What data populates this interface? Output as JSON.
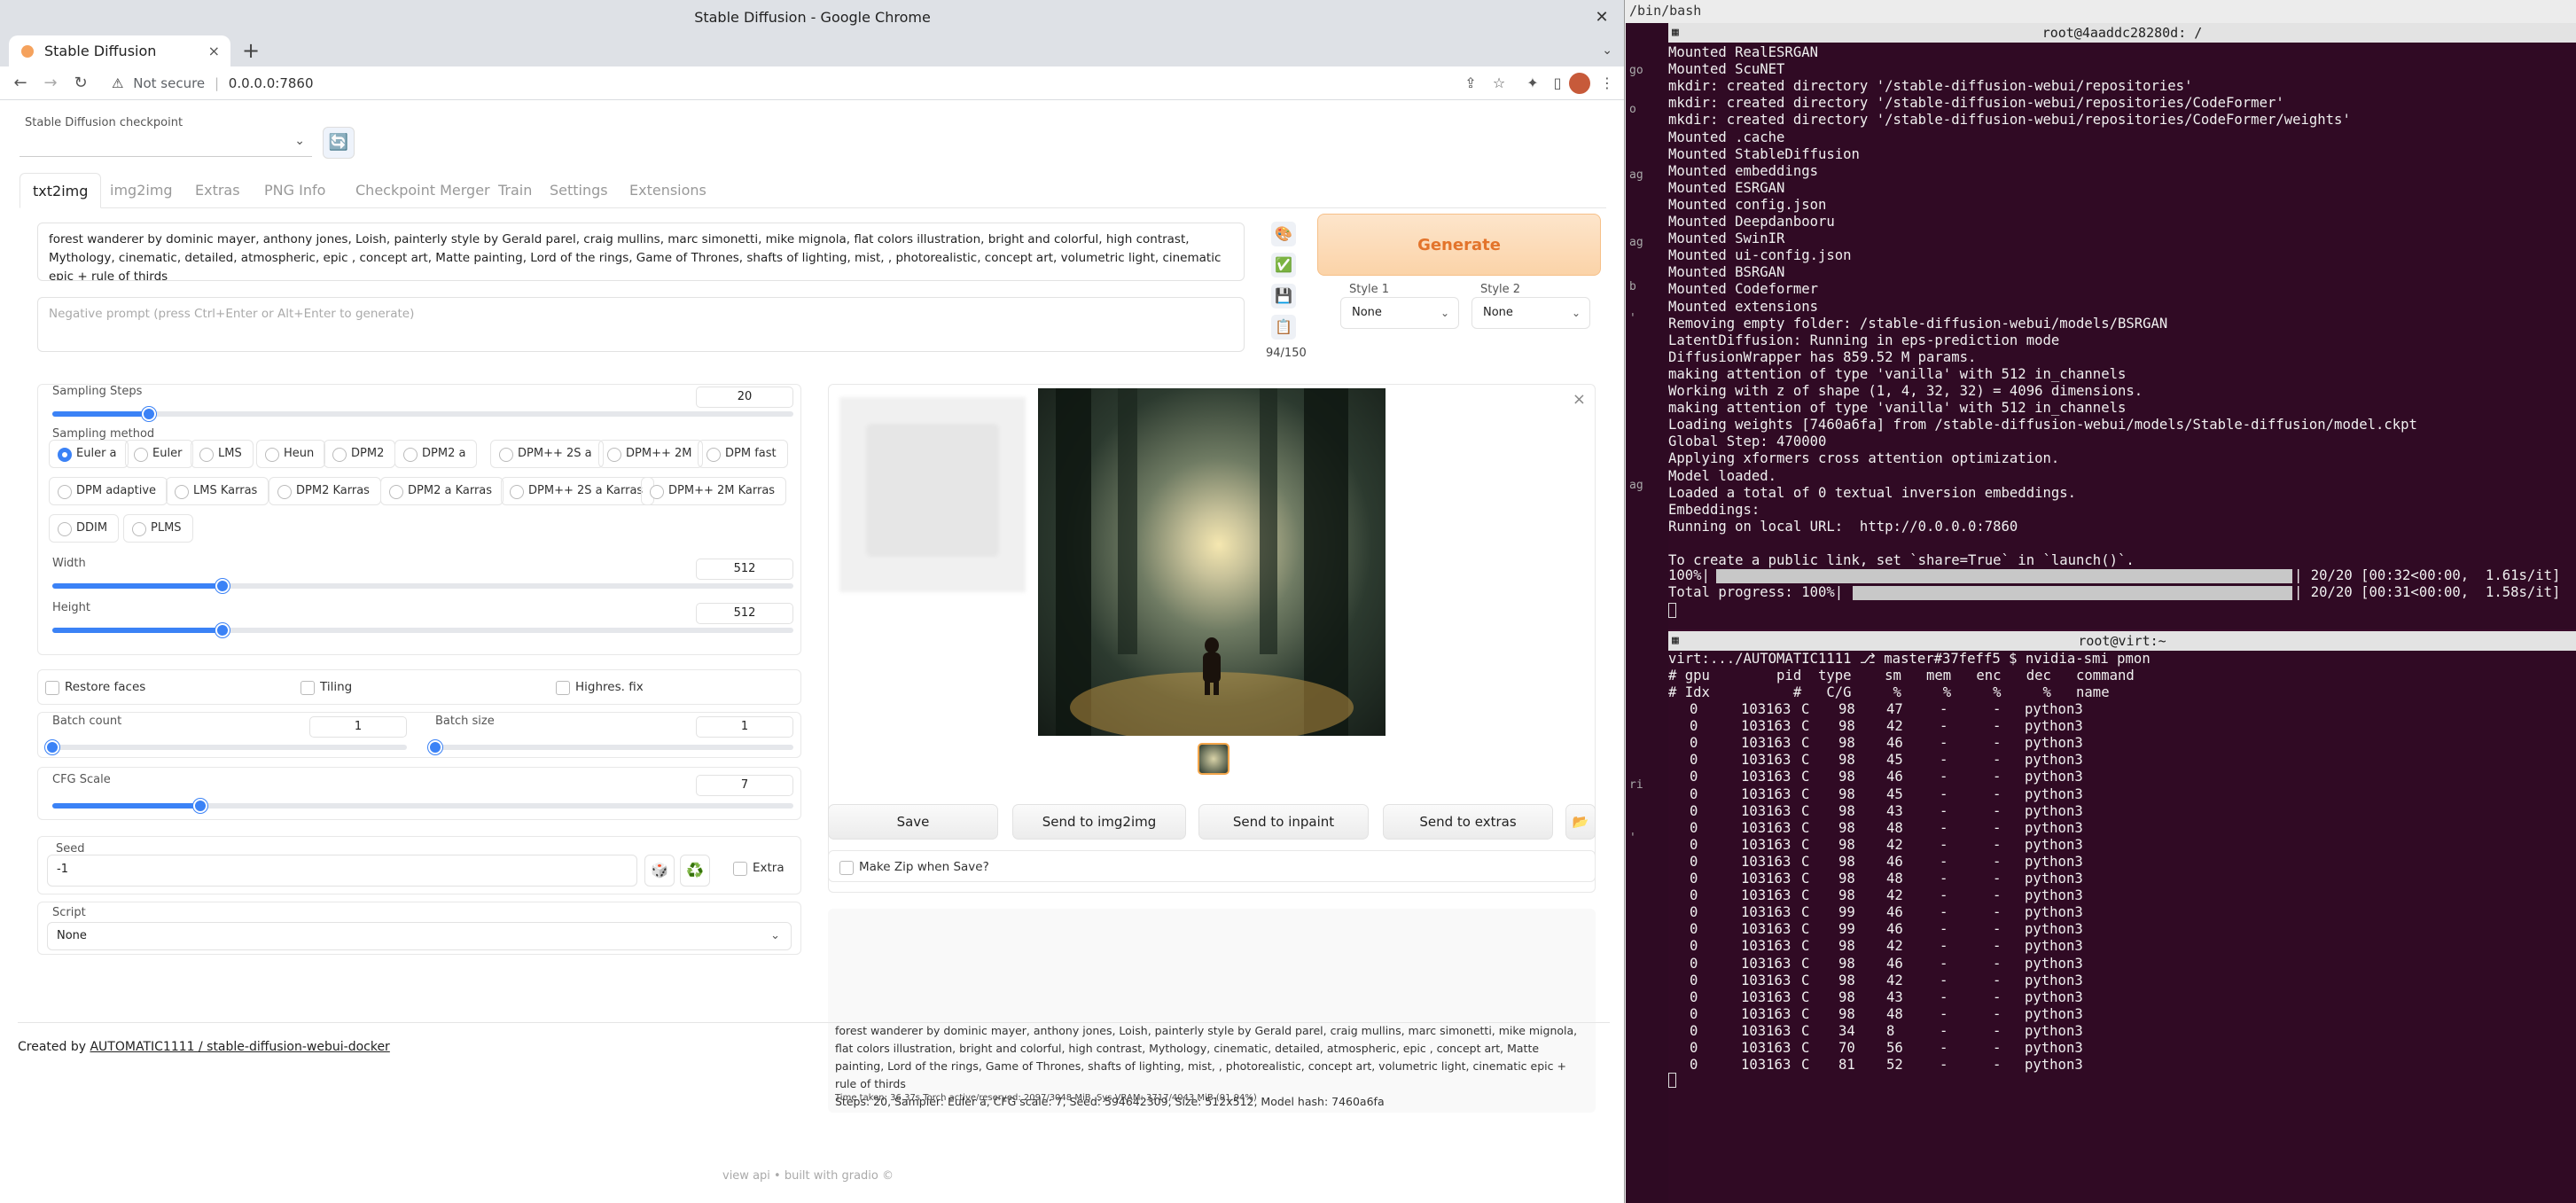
{
  "browser": {
    "window_title": "Stable Diffusion - Google Chrome",
    "tab_title": "Stable Diffusion",
    "new_tab": "+",
    "tab_close": "×",
    "tab_menu": "⌄",
    "not_secure": "Not secure",
    "url": "0.0.0.0:7860"
  },
  "checkpoint": {
    "label": "Stable Diffusion checkpoint",
    "value": "",
    "refresh_icon": "🔄"
  },
  "tabs": [
    "txt2img",
    "img2img",
    "Extras",
    "PNG Info",
    "Checkpoint Merger",
    "Train",
    "Settings",
    "Extensions"
  ],
  "prompt": {
    "value": "forest wanderer by dominic mayer, anthony jones, Loish, painterly style by Gerald parel, craig mullins, marc simonetti, mike mignola, flat colors illustration, bright and colorful, high contrast, Mythology, cinematic, detailed, atmospheric, epic , concept art, Matte painting, Lord of the rings, Game of Thrones, shafts of lighting, mist, , photorealistic, concept art, volumetric light, cinematic epic + rule of thirds",
    "negative_placeholder": "Negative prompt (press Ctrl+Enter or Alt+Enter to generate)",
    "token_count": "94/150",
    "side_icons": [
      "🎨",
      "✅",
      "💾",
      "📋"
    ]
  },
  "generate_label": "Generate",
  "styles": {
    "style1_label": "Style 1",
    "style1_value": "None",
    "style2_label": "Style 2",
    "style2_value": "None"
  },
  "sampling_steps": {
    "label": "Sampling Steps",
    "value": "20",
    "fraction": 0.13
  },
  "sampling_method": {
    "label": "Sampling method",
    "options": [
      "Euler a",
      "Euler",
      "LMS",
      "Heun",
      "DPM2",
      "DPM2 a",
      "DPM++ 2S a",
      "DPM++ 2M",
      "DPM fast",
      "DPM adaptive",
      "LMS Karras",
      "DPM2 Karras",
      "DPM2 a Karras",
      "DPM++ 2S a Karras",
      "DPM++ 2M Karras",
      "DDIM",
      "PLMS"
    ],
    "selected": "Euler a"
  },
  "width": {
    "label": "Width",
    "value": "512",
    "fraction": 0.23
  },
  "height": {
    "label": "Height",
    "value": "512",
    "fraction": 0.23
  },
  "checkboxes": {
    "restore_faces": "Restore faces",
    "tiling": "Tiling",
    "highres_fix": "Highres. fix"
  },
  "batch_count": {
    "label": "Batch count",
    "value": "1",
    "fraction": 0.0
  },
  "batch_size": {
    "label": "Batch size",
    "value": "1",
    "fraction": 0.0
  },
  "cfg_scale": {
    "label": "CFG Scale",
    "value": "7",
    "fraction": 0.2
  },
  "seed": {
    "label": "Seed",
    "value": "-1",
    "dice_icon": "🎲",
    "recycle_icon": "♻️",
    "extra_label": "Extra"
  },
  "script": {
    "label": "Script",
    "value": "None"
  },
  "output": {
    "close_icon": "×",
    "buttons": [
      "Save",
      "Send to img2img",
      "Send to inpaint",
      "Send to extras"
    ],
    "folder_icon": "📂",
    "make_zip_label": "Make Zip when Save?",
    "info": "forest wanderer by dominic mayer, anthony jones, Loish, painterly style by Gerald parel, craig mullins, marc simonetti, mike mignola, flat colors illustration, bright and colorful, high contrast, Mythology, cinematic, detailed, atmospheric, epic , concept art, Matte painting, Lord of the rings, Game of Thrones, shafts of lighting, mist, , photorealistic, concept art, volumetric light, cinematic epic + rule of thirds",
    "params": "Steps: 20, Sampler: Euler a, CFG scale: 7, Seed: 594642309, Size: 512x512, Model hash: 7460a6fa",
    "time": "Time taken: 36.37s  Torch active/reserved: 2097/3048 MiB, Sys VRAM: 3717/4043 MiB (91.94%)"
  },
  "footer": {
    "created_by": "Created by ",
    "link": "AUTOMATIC1111 / stable-diffusion-webui-docker",
    "api": "view api  •  built with gradio  ©"
  },
  "terminal": {
    "header": "/bin/bash",
    "left_strip": [
      "go",
      "o",
      "ag",
      "ag",
      "b",
      "ag",
      "'",
      "ri",
      "'"
    ],
    "pane1_title": "root@4aaddc28280d: /",
    "pane1_lines": [
      "Mounted RealESRGAN",
      "Mounted ScuNET",
      "mkdir: created directory '/stable-diffusion-webui/repositories'",
      "mkdir: created directory '/stable-diffusion-webui/repositories/CodeFormer'",
      "mkdir: created directory '/stable-diffusion-webui/repositories/CodeFormer/weights'",
      "Mounted .cache",
      "Mounted StableDiffusion",
      "Mounted embeddings",
      "Mounted ESRGAN",
      "Mounted config.json",
      "Mounted Deepdanbooru",
      "Mounted SwinIR",
      "Mounted ui-config.json",
      "Mounted BSRGAN",
      "Mounted Codeformer",
      "Mounted extensions",
      "Removing empty folder: /stable-diffusion-webui/models/BSRGAN",
      "LatentDiffusion: Running in eps-prediction mode",
      "DiffusionWrapper has 859.52 M params.",
      "making attention of type 'vanilla' with 512 in_channels",
      "Working with z of shape (1, 4, 32, 32) = 4096 dimensions.",
      "making attention of type 'vanilla' with 512 in_channels",
      "Loading weights [7460a6fa] from /stable-diffusion-webui/models/Stable-diffusion/model.ckpt",
      "Global Step: 470000",
      "Applying xformers cross attention optimization.",
      "Model loaded.",
      "Loaded a total of 0 textual inversion embeddings.",
      "Embeddings:",
      "Running on local URL:  http://0.0.0.0:7860",
      "",
      "To create a public link, set `share=True` in `launch()`."
    ],
    "progress": [
      {
        "left": "100%|",
        "right": "| 20/20 [00:32<00:00,  1.61s/it]"
      },
      {
        "left": "Total progress: 100%|",
        "right": "| 20/20 [00:31<00:00,  1.58s/it]"
      }
    ],
    "pane2_title": "root@virt:~",
    "pane2_prompt": "virt:.../AUTOMATIC1111 ⎇ master#37feff5 $ nvidia-smi pmon",
    "pane2_header": [
      "# gpu        pid  type    sm   mem   enc   dec   command",
      "# Idx          #   C/G     %     %     %     %   name"
    ],
    "pmon_rows": [
      [
        "0",
        "103163",
        "C",
        "98",
        "47",
        "-",
        "-",
        "python3"
      ],
      [
        "0",
        "103163",
        "C",
        "98",
        "42",
        "-",
        "-",
        "python3"
      ],
      [
        "0",
        "103163",
        "C",
        "98",
        "46",
        "-",
        "-",
        "python3"
      ],
      [
        "0",
        "103163",
        "C",
        "98",
        "45",
        "-",
        "-",
        "python3"
      ],
      [
        "0",
        "103163",
        "C",
        "98",
        "46",
        "-",
        "-",
        "python3"
      ],
      [
        "0",
        "103163",
        "C",
        "98",
        "45",
        "-",
        "-",
        "python3"
      ],
      [
        "0",
        "103163",
        "C",
        "98",
        "43",
        "-",
        "-",
        "python3"
      ],
      [
        "0",
        "103163",
        "C",
        "98",
        "48",
        "-",
        "-",
        "python3"
      ],
      [
        "0",
        "103163",
        "C",
        "98",
        "42",
        "-",
        "-",
        "python3"
      ],
      [
        "0",
        "103163",
        "C",
        "98",
        "46",
        "-",
        "-",
        "python3"
      ],
      [
        "0",
        "103163",
        "C",
        "98",
        "48",
        "-",
        "-",
        "python3"
      ],
      [
        "0",
        "103163",
        "C",
        "98",
        "42",
        "-",
        "-",
        "python3"
      ],
      [
        "0",
        "103163",
        "C",
        "99",
        "46",
        "-",
        "-",
        "python3"
      ],
      [
        "0",
        "103163",
        "C",
        "99",
        "46",
        "-",
        "-",
        "python3"
      ],
      [
        "0",
        "103163",
        "C",
        "98",
        "42",
        "-",
        "-",
        "python3"
      ],
      [
        "0",
        "103163",
        "C",
        "98",
        "46",
        "-",
        "-",
        "python3"
      ],
      [
        "0",
        "103163",
        "C",
        "98",
        "42",
        "-",
        "-",
        "python3"
      ],
      [
        "0",
        "103163",
        "C",
        "98",
        "43",
        "-",
        "-",
        "python3"
      ],
      [
        "0",
        "103163",
        "C",
        "98",
        "48",
        "-",
        "-",
        "python3"
      ],
      [
        "0",
        "103163",
        "C",
        "34",
        "8",
        "-",
        "-",
        "python3"
      ],
      [
        "0",
        "103163",
        "C",
        "70",
        "56",
        "-",
        "-",
        "python3"
      ],
      [
        "0",
        "103163",
        "C",
        "81",
        "52",
        "-",
        "-",
        "python3"
      ]
    ]
  }
}
